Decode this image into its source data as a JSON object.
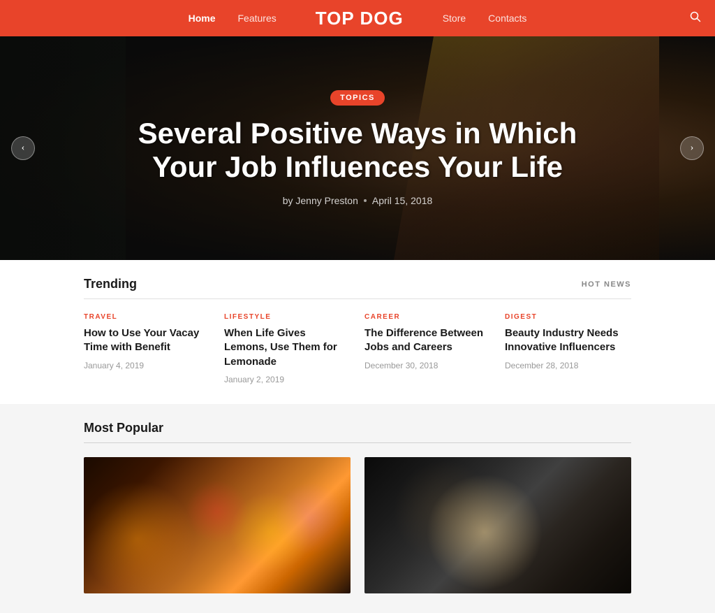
{
  "header": {
    "logo": "TOP DOG",
    "nav": [
      {
        "label": "Home",
        "active": true
      },
      {
        "label": "Features",
        "active": false
      },
      {
        "label": "Store",
        "active": false
      },
      {
        "label": "Contacts",
        "active": false
      }
    ],
    "search_label": "search"
  },
  "hero": {
    "tag": "TOPICS",
    "title": "Several Positive Ways in Which Your Job Influences Your Life",
    "author": "by Jenny Preston",
    "date": "April 15, 2018",
    "arrow_left": "‹",
    "arrow_right": "›"
  },
  "trending": {
    "section_title": "Trending",
    "badge": "HOT NEWS",
    "cards": [
      {
        "category": "TRAVEL",
        "cat_class": "cat-travel",
        "title": "How to Use Your Vacay Time with Benefit",
        "date": "January 4, 2019"
      },
      {
        "category": "LIFESTYLE",
        "cat_class": "cat-lifestyle",
        "title": "When Life Gives Lemons, Use Them for Lemonade",
        "date": "January 2, 2019"
      },
      {
        "category": "CAREER",
        "cat_class": "cat-career",
        "title": "The Difference Between Jobs and Careers",
        "date": "December 30, 2018"
      },
      {
        "category": "DIGEST",
        "cat_class": "cat-digest",
        "title": "Beauty Industry Needs Innovative Influencers",
        "date": "December 28, 2018"
      }
    ]
  },
  "popular": {
    "section_title": "Most Popular",
    "cards": [
      {
        "style": "popular-card-left"
      },
      {
        "style": "popular-card-right"
      }
    ]
  }
}
